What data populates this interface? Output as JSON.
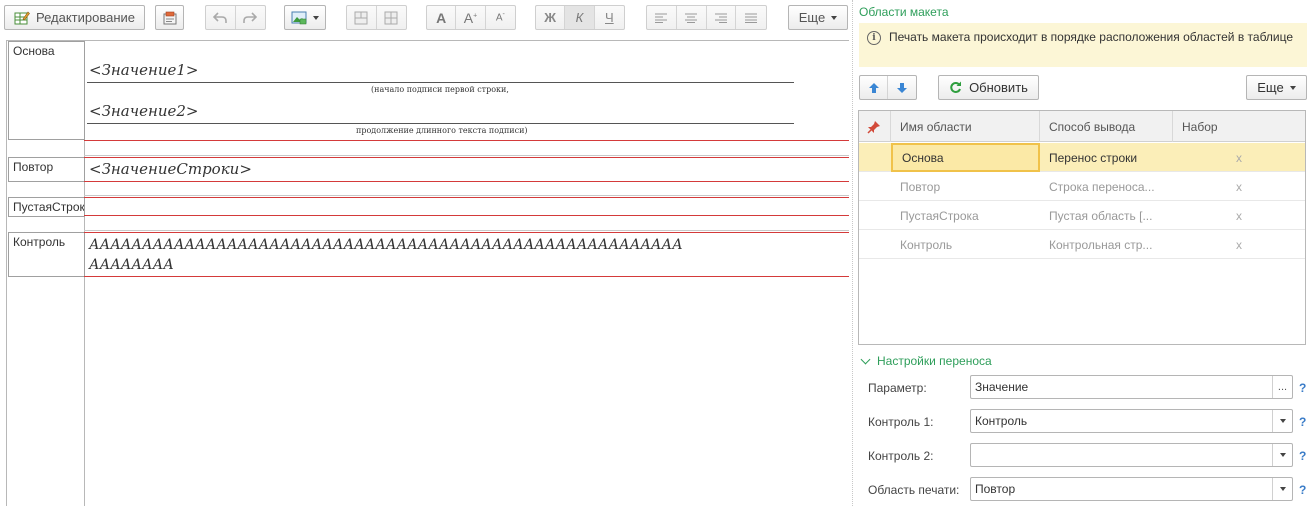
{
  "toolbar": {
    "edit_label": "Редактирование",
    "more_label": "Еще",
    "bold_glyph": "Ж",
    "italic_glyph": "К",
    "underline_glyph": "Ч",
    "font_glyph": "A"
  },
  "sheet": {
    "areas": [
      {
        "label": "Основа"
      },
      {
        "label": "Повтор"
      },
      {
        "label": "ПустаяСтрока"
      },
      {
        "label": "Контроль"
      }
    ],
    "fields": {
      "value1": "<Значение1>",
      "caption1": "(начало подписи первой строки,",
      "value2": "<Значение2>",
      "caption2": "продолжение длинного текста подписи)",
      "row_value": "<ЗначениеСтроки>",
      "control_line1": "АААААААААААААААААААААААААААААААААААААААААААААААААААААААА",
      "control_line2": "АААААААА"
    }
  },
  "panel": {
    "title": "Области макета",
    "info_text": "Печать макета происходит в порядке расположения областей в таблице",
    "refresh_label": "Обновить",
    "more_label": "Еще",
    "columns": [
      "Имя области",
      "Способ вывода",
      "Набор"
    ],
    "rows": [
      {
        "name": "Основа",
        "mode": "Перенос строки",
        "set": "x"
      },
      {
        "name": "Повтор",
        "mode": "Строка переноса...",
        "set": "x"
      },
      {
        "name": "ПустаяСтрока",
        "mode": "Пустая область [...",
        "set": "x"
      },
      {
        "name": "Контроль",
        "mode": "Контрольная стр...",
        "set": "x"
      }
    ],
    "settings_title": "Настройки переноса",
    "params": [
      {
        "label": "Параметр:",
        "value": "Значение"
      },
      {
        "label": "Контроль 1:",
        "value": "Контроль"
      },
      {
        "label": "Контроль 2:",
        "value": ""
      },
      {
        "label": "Область печати:",
        "value": "Повтор"
      }
    ],
    "help": "?",
    "ellipsis": "..."
  },
  "colors": {
    "accent_green": "#2e9e5a",
    "selection": "#fbeeb8",
    "area_border": "#d43a3a"
  }
}
